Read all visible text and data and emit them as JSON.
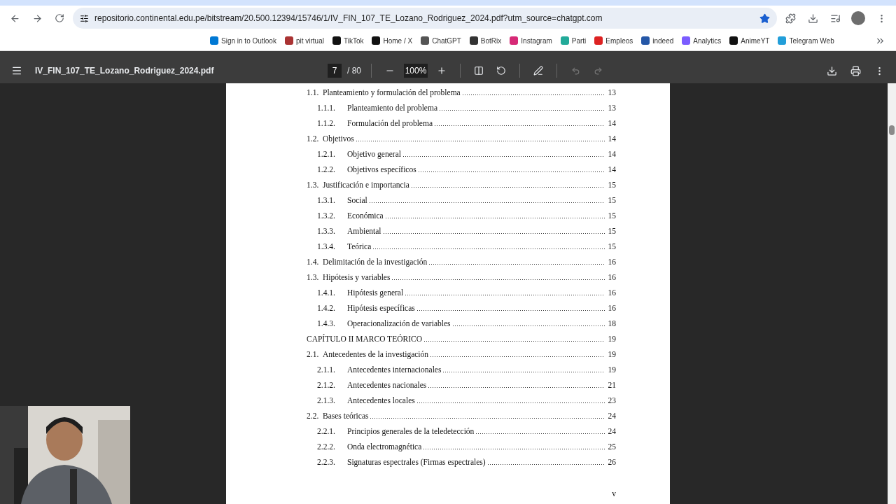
{
  "browser": {
    "url": "repositorio.continental.edu.pe/bitstream/20.500.12394/15746/1/IV_FIN_107_TE_Lozano_Rodriguez_2024.pdf?utm_source=chatgpt.com",
    "bookmarked": true,
    "bookmarks": [
      {
        "label": "Sign in to Outlook"
      },
      {
        "label": "pit virtual"
      },
      {
        "label": "TikTok"
      },
      {
        "label": "Home / X"
      },
      {
        "label": "ChatGPT"
      },
      {
        "label": "BotRix"
      },
      {
        "label": "Instagram"
      },
      {
        "label": "Parti"
      },
      {
        "label": "Empleos"
      },
      {
        "label": "indeed"
      },
      {
        "label": "Analytics"
      },
      {
        "label": "AnimeYT"
      },
      {
        "label": "Telegram Web"
      }
    ]
  },
  "pdf_toolbar": {
    "file_name": "IV_FIN_107_TE_Lozano_Rodriguez_2024.pdf",
    "page": "7",
    "page_total": "/ 80",
    "zoom": "100%"
  },
  "toc": [
    {
      "num": "1.1.",
      "title": "Planteamiento y formulación del problema",
      "page": "13",
      "children": [
        {
          "num": "1.1.1.",
          "title": "Planteamiento del problema",
          "page": "13"
        },
        {
          "num": "1.1.2.",
          "title": "Formulación del problema",
          "page": "14"
        }
      ]
    },
    {
      "num": "1.2.",
      "title": "Objetivos",
      "page": "14",
      "children": [
        {
          "num": "1.2.1.",
          "title": "Objetivo general",
          "page": "14"
        },
        {
          "num": "1.2.2.",
          "title": "Objetivos específicos",
          "page": "14"
        }
      ]
    },
    {
      "num": "1.3.",
      "title": "Justificación e importancia",
      "page": "15",
      "children": [
        {
          "num": "1.3.1.",
          "title": "Social",
          "page": "15"
        },
        {
          "num": "1.3.2.",
          "title": "Económica",
          "page": "15"
        },
        {
          "num": "1.3.3.",
          "title": "Ambiental",
          "page": "15"
        },
        {
          "num": "1.3.4.",
          "title": "Teórica",
          "page": "15"
        }
      ]
    },
    {
      "num": "1.4.",
      "title": "Delimitación de la investigación",
      "page": "16"
    },
    {
      "num": "1.3.",
      "title": "Hipótesis y variables",
      "page": "16",
      "children": [
        {
          "num": "1.4.1.",
          "title": "Hipótesis general",
          "page": "16"
        },
        {
          "num": "1.4.2.",
          "title": "Hipótesis específicas",
          "page": "16"
        },
        {
          "num": "1.4.3.",
          "title": "Operacionalización de variables",
          "page": "18"
        }
      ]
    },
    {
      "title": "CAPÍTULO II MARCO TEÓRICO",
      "page": "19"
    },
    {
      "num": "2.1.",
      "title": "Antecedentes de la investigación",
      "page": "19",
      "children": [
        {
          "num": "2.1.1.",
          "title": "Antecedentes internacionales",
          "page": "19"
        },
        {
          "num": "2.1.2.",
          "title": "Antecedentes nacionales",
          "page": "21"
        },
        {
          "num": "2.1.3.",
          "title": "Antecedentes locales",
          "page": "23"
        }
      ]
    },
    {
      "num": "2.2.",
      "title": "Bases teóricas",
      "page": "24",
      "children": [
        {
          "num": "2.2.1.",
          "title": "Principios generales de la teledetección",
          "page": "24"
        },
        {
          "num": "2.2.2.",
          "title": "Onda electromagnética",
          "page": "25"
        },
        {
          "num": "2.2.3.",
          "title": "Signaturas espectrales (Firmas espectrales)",
          "page": "26"
        }
      ]
    }
  ],
  "page_footer": "v"
}
